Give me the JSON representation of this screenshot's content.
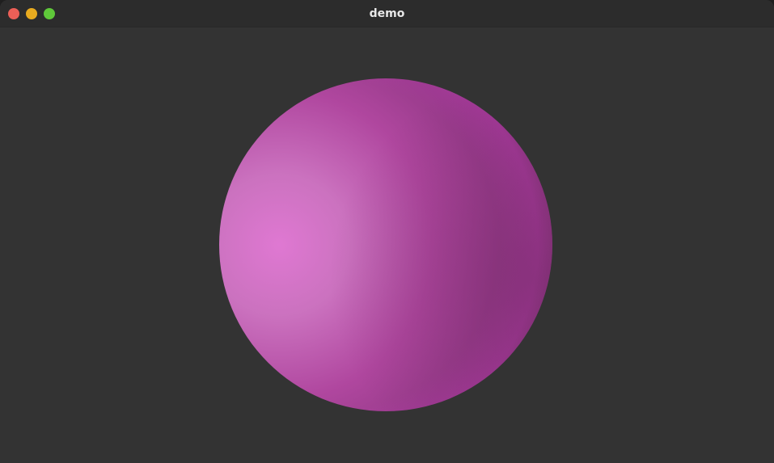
{
  "window": {
    "title": "demo",
    "controls": {
      "close_color": "#ec5f57",
      "minimize_color": "#e8ab1f",
      "maximize_color": "#5fc83a"
    }
  },
  "scene": {
    "background_color": "#333333",
    "sphere_color": "#b0479f"
  }
}
